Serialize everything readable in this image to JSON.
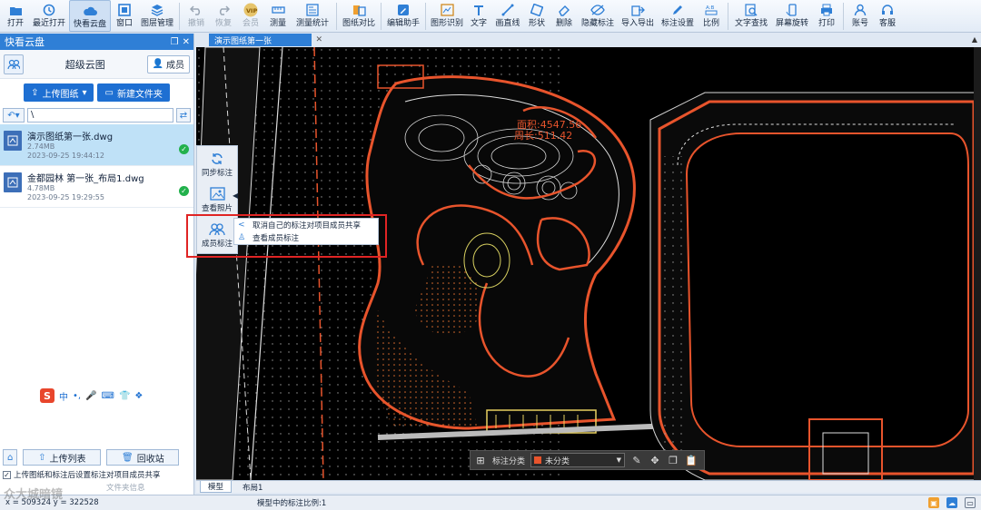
{
  "toolbar": {
    "items": [
      {
        "label": "打开",
        "icon": "folder-open-icon"
      },
      {
        "label": "最近打开",
        "icon": "history-icon"
      },
      {
        "label": "快看云盘",
        "icon": "cloud-icon"
      },
      {
        "label": "窗口",
        "icon": "window-icon"
      },
      {
        "label": "图层管理",
        "icon": "layers-icon"
      },
      {
        "label": "撤销",
        "icon": "undo-icon"
      },
      {
        "label": "恢复",
        "icon": "redo-icon"
      },
      {
        "label": "会员",
        "icon": "vip-icon"
      },
      {
        "label": "测量",
        "icon": "ruler-icon"
      },
      {
        "label": "测量统计",
        "icon": "measure-stats-icon"
      },
      {
        "label": "图纸对比",
        "icon": "compare-icon"
      },
      {
        "label": "编辑助手",
        "icon": "edit-assistant-icon"
      },
      {
        "label": "图形识别",
        "icon": "shape-recognize-icon"
      },
      {
        "label": "文字",
        "icon": "text-icon"
      },
      {
        "label": "画直线",
        "icon": "line-icon"
      },
      {
        "label": "形状",
        "icon": "shape-icon"
      },
      {
        "label": "删除",
        "icon": "eraser-icon"
      },
      {
        "label": "隐藏标注",
        "icon": "hide-annotation-icon"
      },
      {
        "label": "导入导出",
        "icon": "import-export-icon"
      },
      {
        "label": "标注设置",
        "icon": "annotation-settings-icon"
      },
      {
        "label": "比例",
        "icon": "scale-icon"
      },
      {
        "label": "文字查找",
        "icon": "text-search-icon"
      },
      {
        "label": "屏幕旋转",
        "icon": "rotate-icon"
      },
      {
        "label": "打印",
        "icon": "printer-icon"
      },
      {
        "label": "账号",
        "icon": "user-icon"
      },
      {
        "label": "客服",
        "icon": "headset-icon"
      }
    ]
  },
  "panel": {
    "title": "快看云盘",
    "cloud_title": "超级云图",
    "member_label": "成员",
    "upload_label": "上传图纸",
    "new_folder_label": "新建文件夹",
    "path_value": "\\",
    "files": [
      {
        "name": "演示图纸第一张.dwg",
        "size": "2.74MB",
        "date": "2023-09-25 19:44:12"
      },
      {
        "name": "金都园林 第一张_布局1.dwg",
        "size": "4.78MB",
        "date": "2023-09-25 19:29:55"
      }
    ],
    "ime_label": "中",
    "upload_list_label": "上传列表",
    "recycle_label": "回收站",
    "checkbox1_label": "上传图纸和标注后设置标注对项目成员共享",
    "checkbox2_label": "文件夹信息"
  },
  "doc_tab": {
    "title": "演示图纸第一张"
  },
  "side_panel": {
    "items": [
      {
        "label": "同步标注",
        "icon": "sync-icon"
      },
      {
        "label": "查看照片",
        "icon": "photo-icon"
      },
      {
        "label": "成员标注",
        "icon": "members-icon"
      }
    ]
  },
  "context_menu": {
    "items": [
      {
        "label": "取消自己的标注对项目成员共享",
        "icon": "share-icon"
      },
      {
        "label": "查看成员标注",
        "icon": "person-icon"
      }
    ]
  },
  "drawing": {
    "text_area": "面积:4547.56",
    "text_perimeter": "周长:511.42"
  },
  "filter_bar": {
    "label": "标注分类",
    "selected": "未分类"
  },
  "layout_tabs": [
    "模型",
    "布局1"
  ],
  "status": {
    "coords": "x = 509324  y = 322528",
    "ratio": "模型中的标注比例:1"
  },
  "watermark": "众大城暗镜",
  "colors": {
    "accent": "#2f7fd6",
    "cad_orange": "#e8542c",
    "cad_white": "#e8e8e8",
    "highlight_red": "#e02424",
    "ok_green": "#22b14c"
  }
}
